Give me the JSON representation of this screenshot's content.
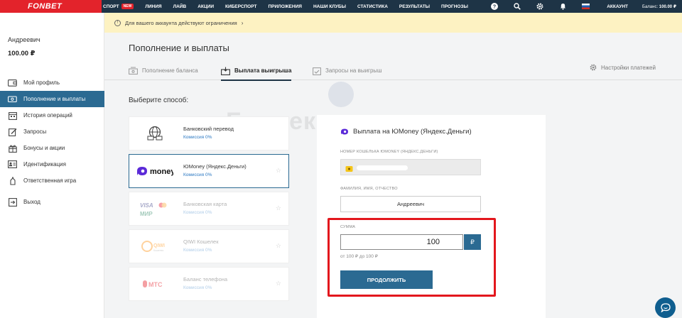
{
  "header": {
    "logo": "FONBET",
    "nav": [
      {
        "label": "СПОРТ",
        "badge": "NEW"
      },
      {
        "label": "ЛИНИЯ"
      },
      {
        "label": "ЛАЙВ"
      },
      {
        "label": "АКЦИИ"
      },
      {
        "label": "КИБЕРСПОРТ"
      },
      {
        "label": "ПРИЛОЖЕНИЯ"
      },
      {
        "label": "НАШИ КЛУБЫ"
      },
      {
        "label": "СТАТИСТИКА"
      },
      {
        "label": "РЕЗУЛЬТАТЫ"
      },
      {
        "label": "ПРОГНОЗЫ"
      }
    ],
    "account_label": "АККАУНТ",
    "balance_label": "Баланс:",
    "balance_value": "100.00 ₽"
  },
  "banner": {
    "text": "Для вашего аккаунта действуют ограничения"
  },
  "sidebar": {
    "user_name": "Андреевич",
    "user_balance": "100.00 ₽",
    "items": [
      {
        "label": "Мой профиль",
        "icon": "wallet-icon"
      },
      {
        "label": "Пополнение и выплаты",
        "icon": "cash-icon",
        "active": true
      },
      {
        "label": "История операций",
        "icon": "calendar-icon"
      },
      {
        "label": "Запросы",
        "icon": "pencil-icon"
      },
      {
        "label": "Бонусы и акции",
        "icon": "gift-icon"
      },
      {
        "label": "Идентификация",
        "icon": "id-card-icon"
      },
      {
        "label": "Ответственная игра",
        "icon": "hand-icon"
      },
      {
        "label": "Выход",
        "icon": "logout-icon"
      }
    ]
  },
  "main": {
    "title": "Пополнение и выплаты",
    "tabs": [
      {
        "label": "Пополнение баланса"
      },
      {
        "label": "Выплата выигрыша",
        "active": true
      },
      {
        "label": "Запросы на выигрыш"
      }
    ],
    "settings_label": "Настройки платежей",
    "choose_label": "Выберите способ:",
    "methods": [
      {
        "name": "Банковский перевод",
        "fee": "Комиссия 0%",
        "logo": "bank-transfer-icon"
      },
      {
        "name": "ЮMoney (Яндекс.Деньги)",
        "fee": "Комиссия 0%",
        "logo": "yoomoney-logo",
        "selected": true,
        "logo_text": "money"
      },
      {
        "name": "Банковская карта",
        "fee": "Комиссия 0%",
        "logo": "cards-logo",
        "logo_text": [
          "VISA",
          "МИР"
        ]
      },
      {
        "name": "QIWI Кошелек",
        "fee": "Комиссия 0%",
        "logo": "qiwi-logo",
        "logo_text": [
          "QIWI",
          "Кошелек"
        ]
      },
      {
        "name": "Баланс телефона",
        "fee": "Комиссия 0%",
        "logo": "mts-logo",
        "logo_text": "МТС"
      }
    ]
  },
  "panel": {
    "title": "Выплата на ЮMoney (Яндекс.Деньги)",
    "wallet_label": "НОМЕР КОШЕЛЬКА ЮMONEY (ЯНДЕКС.ДЕНЬГИ)",
    "name_label": "ФАМИЛИЯ, ИМЯ, ОТЧЕСТВО",
    "name_value": "Андреевич",
    "sum_label": "СУММА",
    "sum_value": "100",
    "currency": "₽",
    "range": "от 100 ₽ до 100 ₽",
    "submit_label": "ПРОДОЛЖИТЬ"
  },
  "watermark": "Букмекеры.ру",
  "colors": {
    "brand_red": "#e3232b",
    "header_navy": "#1e3446",
    "accent_blue": "#2b6a92",
    "banner_yellow": "#fdf2c2",
    "highlight_red": "#e3171d"
  }
}
